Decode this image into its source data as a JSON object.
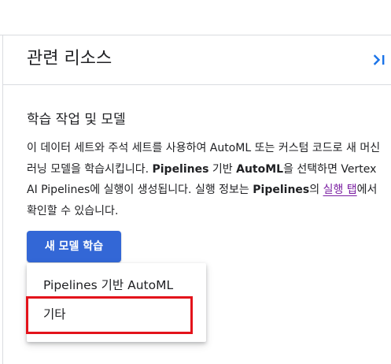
{
  "panel": {
    "title": "관련 리소스",
    "collapse_icon": "chevron-right-with-bar-icon"
  },
  "section": {
    "title": "학습 작업 및 모델",
    "desc": {
      "part1": "이 데이터 세트와 주석 세트를 사용하여 AutoML 또는 커스텀 코드로 새 머신러닝 모델을 학습시킵니다. ",
      "pipelines1": "Pipelines",
      "part2": " 기반 ",
      "automl": "AutoML",
      "part3": "을 선택하면 Vertex AI Pipelines에 실행이 생성됩니다. 실행 정보는 ",
      "pipelines2": "Pipelines",
      "part4": "의 ",
      "link": "실행 탭",
      "part5": "에서 확인할 수 있습니다."
    }
  },
  "train_button": {
    "label": "새 모델 학습"
  },
  "menu": {
    "items": [
      {
        "label": "Pipelines 기반 AutoML"
      },
      {
        "label": "기타"
      }
    ]
  },
  "colors": {
    "primary_button": "#3367d6",
    "link": "#7b1fa2",
    "highlight": "#e3131b",
    "collapse_icon": "#1a73e8"
  }
}
